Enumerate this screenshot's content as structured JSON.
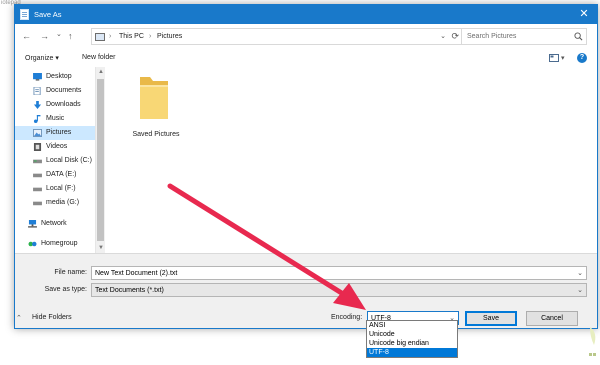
{
  "background_text": "iotepad",
  "window": {
    "title": "Save As",
    "close_glyph": "✕"
  },
  "nav": {
    "back_glyph": "←",
    "forward_glyph": "→",
    "recent_glyph": "⌄",
    "up_glyph": "↑",
    "breadcrumb": [
      "This PC",
      "Pictures"
    ],
    "breadcrumb_sep": "›",
    "dropdown_glyph": "⌄",
    "refresh_glyph": "⟳",
    "search_placeholder": "Search Pictures"
  },
  "toolbar": {
    "organize": "Organize ▾",
    "new_folder": "New folder",
    "view_dropdown": "▾",
    "help": "?"
  },
  "sidebar": {
    "items": [
      {
        "label": "Desktop",
        "icon": "desktop-icon"
      },
      {
        "label": "Documents",
        "icon": "documents-icon"
      },
      {
        "label": "Downloads",
        "icon": "downloads-icon"
      },
      {
        "label": "Music",
        "icon": "music-icon"
      },
      {
        "label": "Pictures",
        "icon": "pictures-icon",
        "selected": true
      },
      {
        "label": "Videos",
        "icon": "videos-icon"
      },
      {
        "label": "Local Disk (C:)",
        "icon": "drive-icon"
      },
      {
        "label": "DATA (E:)",
        "icon": "drive-icon"
      },
      {
        "label": "Local (F:)",
        "icon": "drive-icon"
      },
      {
        "label": "media (G:)",
        "icon": "drive-icon"
      },
      {
        "label": "Network",
        "icon": "network-icon"
      },
      {
        "label": "Homegroup",
        "icon": "homegroup-icon"
      }
    ],
    "scroll_up_glyph": "▲",
    "scroll_down_glyph": "▼"
  },
  "content": {
    "items": [
      {
        "label": "Saved Pictures",
        "icon": "folder-icon"
      }
    ]
  },
  "form": {
    "file_name_label": "File name:",
    "file_name_value": "New Text Document (2).txt",
    "save_type_label": "Save as type:",
    "save_type_value": "Text Documents (*.txt)",
    "dropdown_glyph": "⌄",
    "hide_folders": "Hide Folders",
    "hide_folders_glyph": "⌃",
    "encoding_label": "Encoding:",
    "encoding_value": "UTF-8",
    "save_button": "Save",
    "cancel_button": "Cancel"
  },
  "encoding_options": [
    "ANSI",
    "Unicode",
    "Unicode big endian",
    "UTF-8"
  ],
  "encoding_selected": "UTF-8",
  "colors": {
    "accent": "#1979ca",
    "selection": "#0078d7",
    "sidebar_selected": "#cce8ff",
    "folder": "#f8d775",
    "arrow": "#e8294f"
  }
}
